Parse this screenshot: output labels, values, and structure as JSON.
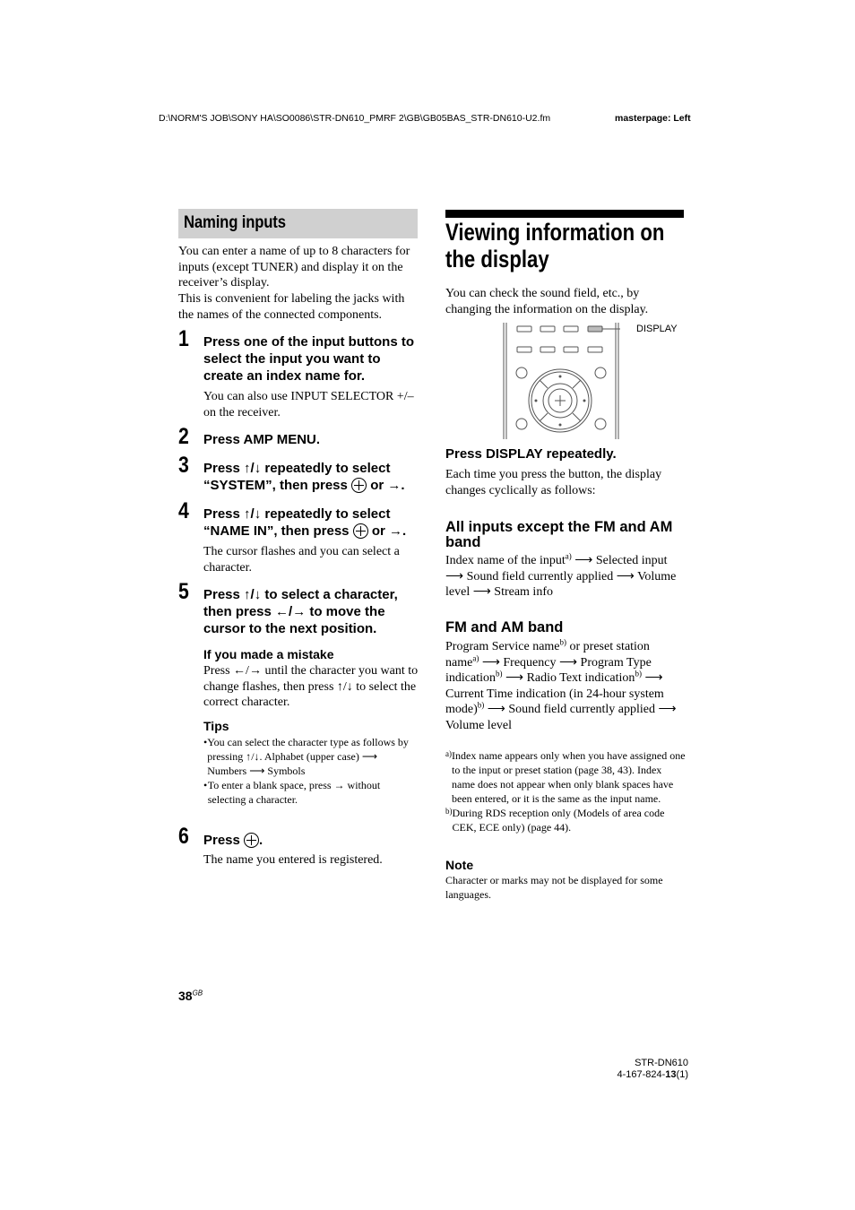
{
  "header": {
    "file_path": "D:\\NORM'S JOB\\SONY HA\\SO0086\\STR-DN610_PMRF 2\\GB\\GB05BAS_STR-DN610-U2.fm",
    "masterpage": "masterpage: Left"
  },
  "left": {
    "section_title": "Naming inputs",
    "intro_1": "You can enter a name of up to 8 characters for inputs (except TUNER) and display it on the receiver’s display.",
    "intro_2": "This is convenient for labeling the jacks with the names of the connected components.",
    "steps": [
      {
        "num": "1",
        "title": "Press one of the input buttons to select the input you want to create an index name for.",
        "note": "You can also use INPUT SELECTOR +/– on the receiver."
      },
      {
        "num": "2",
        "title": "Press AMP MENU."
      },
      {
        "num": "3",
        "title_a": "Press ↑/↓ repeatedly to select “SYSTEM”, then press",
        "title_b": "or →."
      },
      {
        "num": "4",
        "title_a": "Press ↑/↓ repeatedly to select “NAME IN”, then press",
        "title_b": "or →.",
        "note": "The cursor flashes and you can select a character."
      },
      {
        "num": "5",
        "title": "Press ↑/↓ to select a character, then press ←/→ to move the cursor to the next position."
      },
      {
        "num": "6",
        "title_a": "Press",
        "title_b": ".",
        "note": "The name you entered is registered."
      }
    ],
    "mistake": {
      "heading": "If you made a mistake",
      "text": "Press ←/→ until the character you want to change flashes, then press ↑/↓ to select the correct character."
    },
    "tips": {
      "heading": "Tips",
      "items": [
        "You can select the character type as follows by pressing ↑/↓. Alphabet (upper case) ⟶ Numbers ⟶ Symbols",
        "To enter a blank space, press → without selecting a character."
      ]
    }
  },
  "right": {
    "title": "Viewing information on the display",
    "intro": "You can check the sound field, etc., by changing the information on the display.",
    "remote_label": "DISPLAY",
    "instruction": "Press DISPLAY repeatedly.",
    "instruction_text": "Each time you press the button, the display changes cyclically as follows:",
    "all_inputs": {
      "heading": "All inputs except the FM and AM band",
      "text_a": "Index name of the input",
      "sup_a": "a)",
      "text_b": " ⟶ Selected input ⟶ Sound field currently applied ⟶ Volume level ⟶ Stream info"
    },
    "fm_am": {
      "heading": "FM and AM band",
      "p1": "Program Service name",
      "s1": "b)",
      "p2": " or preset station name",
      "s2": "a)",
      "p3": " ⟶ Frequency ⟶ Program Type indication",
      "s3": "b)",
      "p4": " ⟶ Radio Text indication",
      "s4": "b)",
      "p5": " ⟶ Current Time indication (in 24-hour system mode)",
      "s5": "b)",
      "p6": " ⟶ Sound field currently applied ⟶ Volume level"
    },
    "footnotes": [
      {
        "mark": "a)",
        "text": "Index name appears only when you have assigned one to the input or preset station (page 38, 43). Index name does not appear when only blank spaces have been entered, or it is the same as the input name."
      },
      {
        "mark": "b)",
        "text": "During RDS reception only (Models of area code CEK, ECE only) (page 44)."
      }
    ],
    "note": {
      "heading": "Note",
      "text": "Character or marks may not be displayed for some languages."
    }
  },
  "footer": {
    "page_number": "38",
    "page_suffix": "GB",
    "model": "STR-DN610",
    "code_a": "4-167-824-",
    "code_b": "13",
    "code_c": "(1)"
  }
}
